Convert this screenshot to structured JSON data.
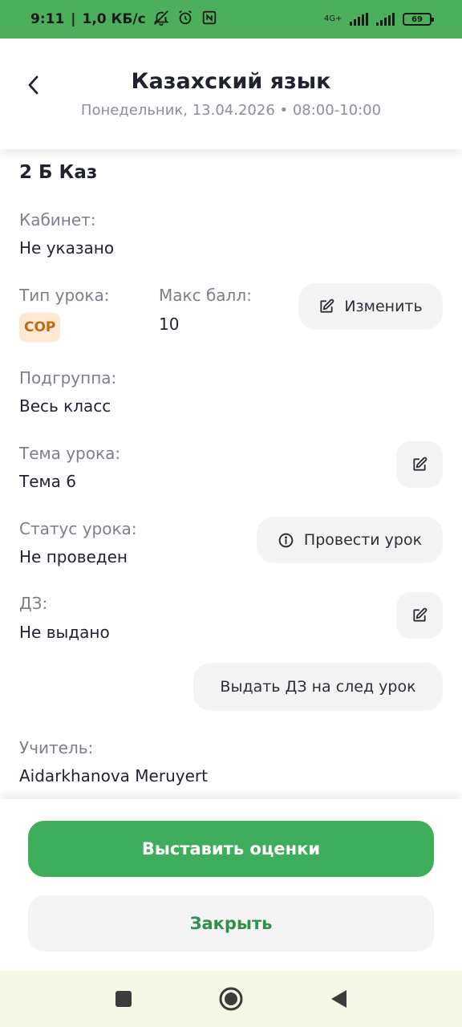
{
  "status_bar": {
    "time": "9:11",
    "separator": "|",
    "speed": "1,0 КБ/с",
    "network": "4G+",
    "battery": "69"
  },
  "header": {
    "title": "Казахский язык",
    "subtitle": "Понедельник, 13.04.2026 • 08:00-10:00"
  },
  "lesson": {
    "class_name": "2 Б Каз",
    "room_label": "Кабинет:",
    "room_value": "Не указано",
    "type_label": "Тип урока:",
    "type_value": "СОР",
    "max_score_label": "Макс балл:",
    "max_score_value": "10",
    "edit_label": "Изменить",
    "subgroup_label": "Подгруппа:",
    "subgroup_value": "Весь класс",
    "topic_label": "Тема урока:",
    "topic_value": "Тема 6",
    "status_label": "Статус урока:",
    "status_value": "Не проведен",
    "conduct_label": "Провести урок",
    "homework_label": "ДЗ:",
    "homework_value": "Не выдано",
    "assign_homework_label": "Выдать ДЗ на след урок",
    "teacher_label": "Учитель:",
    "teacher_value": "Aidarkhanova Meruyert"
  },
  "actions": {
    "grade_label": "Выставить оценки",
    "close_label": "Закрыть"
  },
  "colors": {
    "status_bar": "#4caf5b",
    "primary": "#3fae5c",
    "close_text": "#2f8f4c",
    "badge_bg": "#fde8d4",
    "badge_text": "#c06a14"
  }
}
